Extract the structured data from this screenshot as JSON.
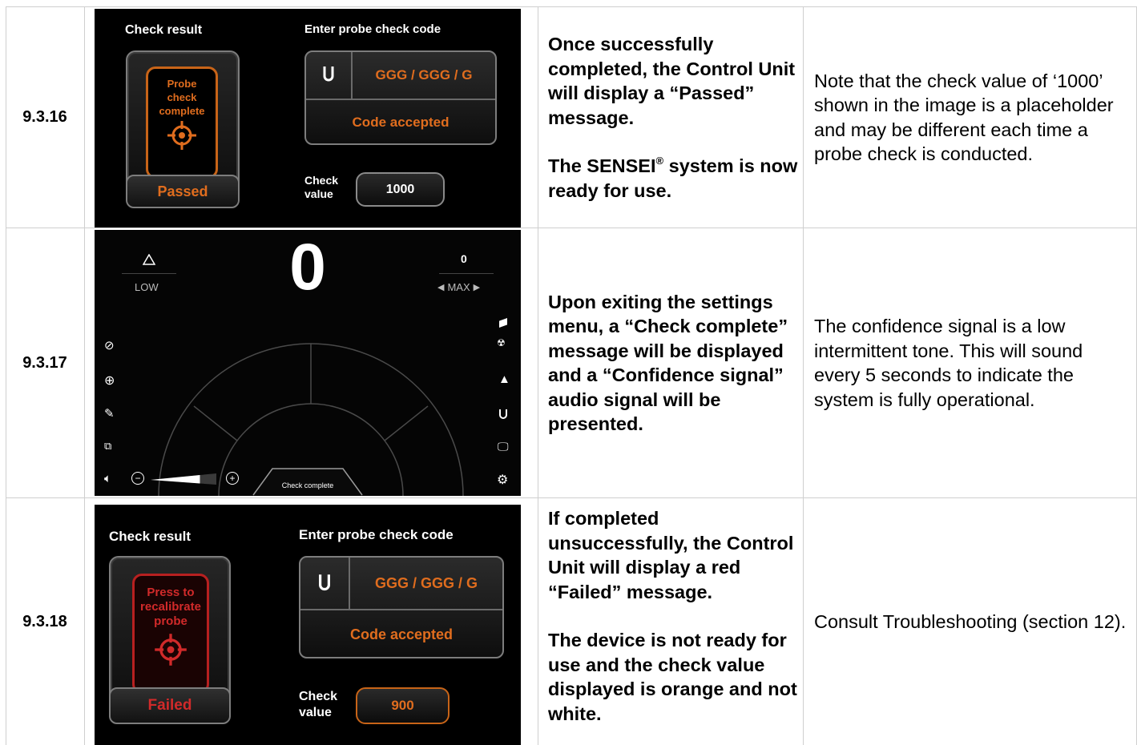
{
  "colors": {
    "orange": "#e06d1e",
    "red": "#d12a2a",
    "border": "#cfcfcf"
  },
  "rows": [
    {
      "number": "9.3.16",
      "screen": {
        "check_result_label": "Check result",
        "enter_code_label": "Enter probe check code",
        "probe_card_lines": [
          "Probe",
          "check",
          "complete"
        ],
        "status": "Passed",
        "code": "GGG / GGG / G",
        "code_status": "Code accepted",
        "check_value_label_1": "Check",
        "check_value_label_2": "value",
        "check_value": "1000"
      },
      "description_p1": "Once successfully completed, the Control Unit will display a “Passed” message.",
      "description_p2a": "The SENSEI",
      "description_p2_sup": "®",
      "description_p2b": " system is now ready for use.",
      "note": "Note that the check value of ‘1000’ shown in the image is a placeholder and may be different each time a probe check is conducted."
    },
    {
      "number": "9.3.17",
      "screen": {
        "big_value": "0",
        "left_label": "LOW",
        "right_value": "0",
        "right_label": "MAX",
        "check_complete_tab": "Check complete",
        "volume_level": 0.75
      },
      "description": "Upon exiting the settings menu, a “Check complete” message will be displayed and a “Confidence signal” audio signal will be presented.",
      "note": "The confidence signal is a low intermittent tone. This will sound every 5 seconds to indicate the system is fully operational."
    },
    {
      "number": "9.3.18",
      "screen": {
        "check_result_label": "Check result",
        "enter_code_label": "Enter probe check code",
        "probe_card_lines": [
          "Press to",
          "recalibrate",
          "probe"
        ],
        "status": "Failed",
        "code": "GGG / GGG / G",
        "code_status": "Code accepted",
        "check_value_label_1": "Check",
        "check_value_label_2": "value",
        "check_value": "900"
      },
      "description_p1": "If completed unsuccessfully, the Control Unit will display a red “Failed” message.",
      "description_p2": "The device is not ready for use and the check value displayed is orange and not white.",
      "note": "Consult Troubleshooting (section 12)."
    }
  ]
}
